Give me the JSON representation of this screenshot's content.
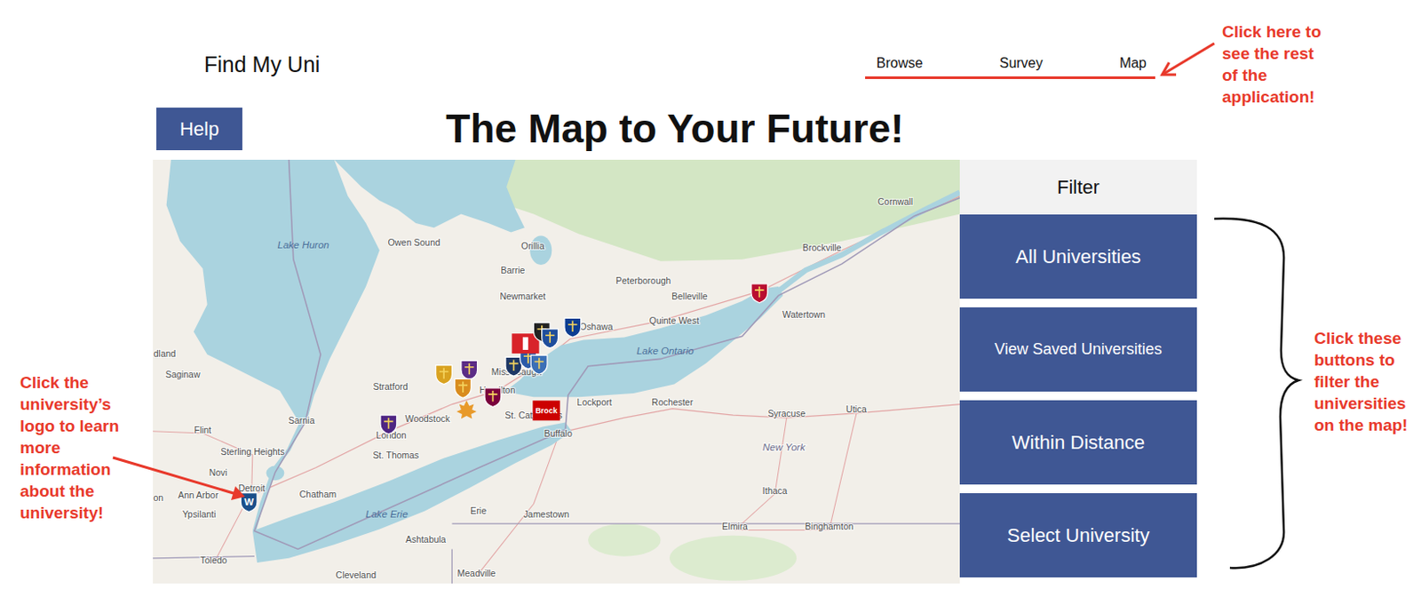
{
  "app": {
    "brand": "Find My Uni",
    "nav": [
      "Browse",
      "Survey",
      "Map"
    ]
  },
  "help_button": "Help",
  "title": "The Map to Your Future!",
  "map": {
    "labels": [
      {
        "text": "Lake Huron",
        "kind": "water"
      },
      {
        "text": "Owen Sound",
        "kind": "city"
      },
      {
        "text": "Orillia",
        "kind": "city"
      },
      {
        "text": "Barrie",
        "kind": "city"
      },
      {
        "text": "Newmarket",
        "kind": "city"
      },
      {
        "text": "Peterborough",
        "kind": "city"
      },
      {
        "text": "Belleville",
        "kind": "city"
      },
      {
        "text": "Quinte West",
        "kind": "city"
      },
      {
        "text": "Brockville",
        "kind": "city"
      },
      {
        "text": "Cornwall",
        "kind": "city"
      },
      {
        "text": "Watertown",
        "kind": "city"
      },
      {
        "text": "Lake Ontario",
        "kind": "water"
      },
      {
        "text": "Oshawa",
        "kind": "city"
      },
      {
        "text": "Mississauga",
        "kind": "city"
      },
      {
        "text": "Hamilton",
        "kind": "city"
      },
      {
        "text": "Stratford",
        "kind": "city"
      },
      {
        "text": "Woodstock",
        "kind": "city"
      },
      {
        "text": "London",
        "kind": "city"
      },
      {
        "text": "St. Thomas",
        "kind": "city"
      },
      {
        "text": "Sarnia",
        "kind": "city"
      },
      {
        "text": "Saginaw",
        "kind": "city"
      },
      {
        "text": "Flint",
        "kind": "city"
      },
      {
        "text": "Sterling Heights",
        "kind": "city"
      },
      {
        "text": "Novi",
        "kind": "city"
      },
      {
        "text": "Detroit",
        "kind": "city"
      },
      {
        "text": "Ann Arbor",
        "kind": "city"
      },
      {
        "text": "Ypsilanti",
        "kind": "city"
      },
      {
        "text": "Toledo",
        "kind": "city"
      },
      {
        "text": "Chatham",
        "kind": "city"
      },
      {
        "text": "Lake Erie",
        "kind": "water"
      },
      {
        "text": "Erie",
        "kind": "city"
      },
      {
        "text": "Ashtabula",
        "kind": "city"
      },
      {
        "text": "Cleveland",
        "kind": "city"
      },
      {
        "text": "Meadville",
        "kind": "city"
      },
      {
        "text": "Jamestown",
        "kind": "city"
      },
      {
        "text": "Buffalo",
        "kind": "city"
      },
      {
        "text": "Lockport",
        "kind": "city"
      },
      {
        "text": "Rochester",
        "kind": "city"
      },
      {
        "text": "St. Catharines",
        "kind": "city"
      },
      {
        "text": "Syracuse",
        "kind": "city"
      },
      {
        "text": "Utica",
        "kind": "city"
      },
      {
        "text": "New York",
        "kind": "region"
      },
      {
        "text": "Ithaca",
        "kind": "city"
      },
      {
        "text": "Elmira",
        "kind": "city"
      },
      {
        "text": "Binghamton",
        "kind": "city"
      },
      {
        "text": "dland",
        "kind": "city"
      },
      {
        "text": "on",
        "kind": "city"
      }
    ],
    "universities": [
      {
        "kind": "shield",
        "color": "#1b4f8a",
        "mark": "W"
      },
      {
        "kind": "shield",
        "color": "#4f2683",
        "mark": ""
      },
      {
        "kind": "shield",
        "color": "#d9a21f",
        "mark": ""
      },
      {
        "kind": "shield",
        "color": "#5b2c86",
        "mark": ""
      },
      {
        "kind": "shield",
        "color": "#d98c1e",
        "mark": ""
      },
      {
        "kind": "leaf",
        "color": "#e89a2b",
        "mark": ""
      },
      {
        "kind": "shield",
        "color": "#7a003c",
        "mark": ""
      },
      {
        "kind": "square",
        "color": "#cc0000",
        "mark": "Brock"
      },
      {
        "kind": "shield",
        "color": "#1e3765",
        "mark": ""
      },
      {
        "kind": "shield",
        "color": "#2a5aa8",
        "mark": ""
      },
      {
        "kind": "shield",
        "color": "#3b6fb6",
        "mark": ""
      },
      {
        "kind": "square",
        "color": "#d8232a",
        "mark": ""
      },
      {
        "kind": "shield",
        "color": "#222222",
        "mark": ""
      },
      {
        "kind": "shield",
        "color": "#1f4e9c",
        "mark": ""
      },
      {
        "kind": "shield",
        "color": "#0b3d91",
        "mark": ""
      },
      {
        "kind": "shield",
        "color": "#b90e31",
        "mark": ""
      }
    ]
  },
  "filter": {
    "title": "Filter",
    "buttons": [
      "All Universities",
      "View Saved Universities",
      "Within Distance",
      "Select University"
    ]
  },
  "annotations": {
    "nav": "Click here to see the rest of the application!",
    "filters": "Click these buttons to filter the universities on the map!",
    "logo": "Click the university’s logo to learn more information about the university!"
  }
}
